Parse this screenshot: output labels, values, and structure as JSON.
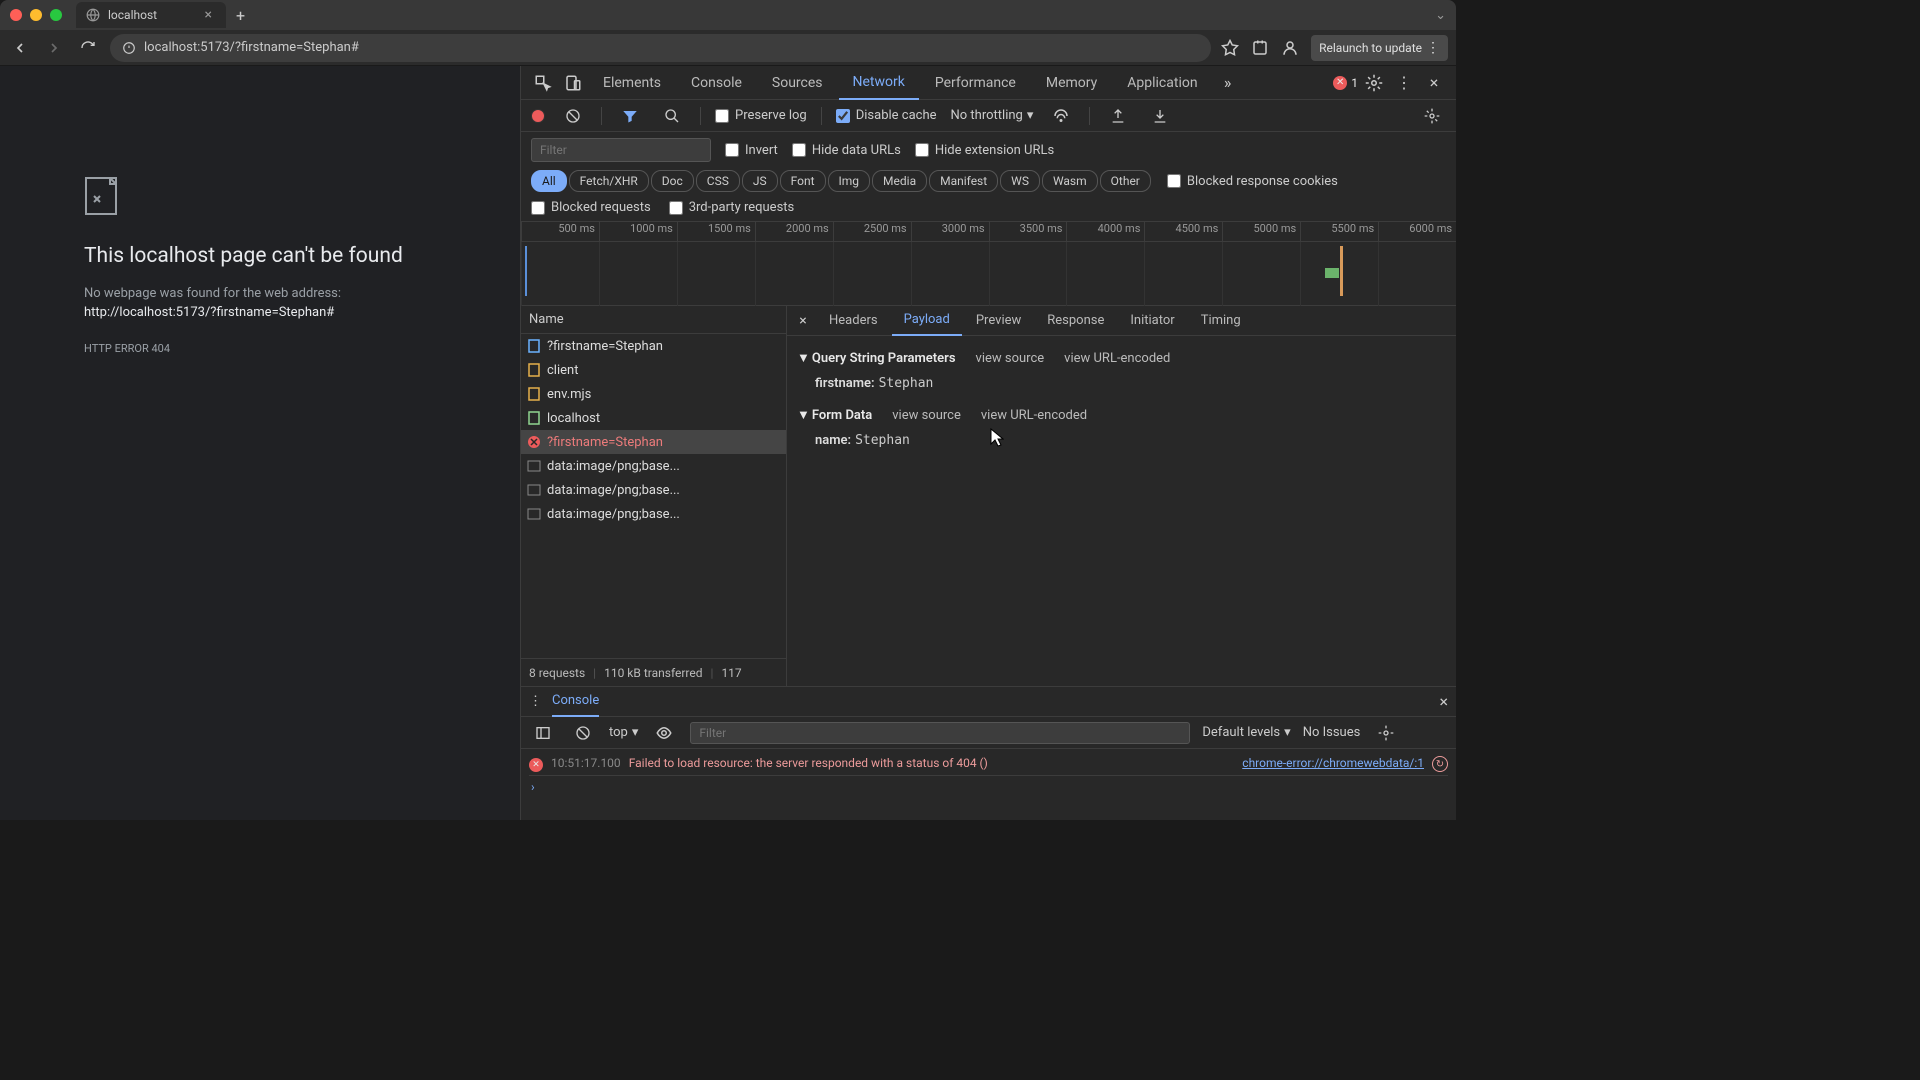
{
  "window": {
    "tab_title": "localhost",
    "url": "localhost:5173/?firstname=Stephan#",
    "relaunch": "Relaunch to update"
  },
  "page": {
    "heading": "This localhost page can't be found",
    "subtext": "No webpage was found for the web address:",
    "requested_url": "http://localhost:5173/?firstname=Stephan#",
    "error_code": "HTTP ERROR 404"
  },
  "devtools": {
    "tabs": [
      "Elements",
      "Console",
      "Sources",
      "Network",
      "Performance",
      "Memory",
      "Application"
    ],
    "active_tab": "Network",
    "error_count": "1"
  },
  "network_toolbar": {
    "preserve_log": "Preserve log",
    "disable_cache": "Disable cache",
    "throttling": "No throttling"
  },
  "filters": {
    "placeholder": "Filter",
    "invert": "Invert",
    "hide_data": "Hide data URLs",
    "hide_ext": "Hide extension URLs",
    "types": [
      "All",
      "Fetch/XHR",
      "Doc",
      "CSS",
      "JS",
      "Font",
      "Img",
      "Media",
      "Manifest",
      "WS",
      "Wasm",
      "Other"
    ],
    "blocked_cookies": "Blocked response cookies",
    "blocked_req": "Blocked requests",
    "third_party": "3rd-party requests"
  },
  "waterfall_ticks": [
    "500 ms",
    "1000 ms",
    "1500 ms",
    "2000 ms",
    "2500 ms",
    "3000 ms",
    "3500 ms",
    "4000 ms",
    "4500 ms",
    "5000 ms",
    "5500 ms",
    "6000 ms"
  ],
  "requests": {
    "header": "Name",
    "rows": [
      {
        "name": "?firstname=Stephan",
        "kind": "doc"
      },
      {
        "name": "client",
        "kind": "js"
      },
      {
        "name": "env.mjs",
        "kind": "js"
      },
      {
        "name": "localhost",
        "kind": "ws"
      },
      {
        "name": "?firstname=Stephan",
        "kind": "error"
      },
      {
        "name": "data:image/png;base...",
        "kind": "img"
      },
      {
        "name": "data:image/png;base...",
        "kind": "img"
      },
      {
        "name": "data:image/png;base...",
        "kind": "img"
      }
    ],
    "footer": {
      "count": "8 requests",
      "transferred": "110 kB transferred",
      "resources": "117"
    }
  },
  "detail": {
    "tabs": [
      "Headers",
      "Payload",
      "Preview",
      "Response",
      "Initiator",
      "Timing"
    ],
    "active": "Payload",
    "qsp": {
      "title": "Query String Parameters",
      "view_source": "view source",
      "view_url": "view URL-encoded",
      "key": "firstname:",
      "val": "Stephan"
    },
    "form": {
      "title": "Form Data",
      "view_source": "view source",
      "view_url": "view URL-encoded",
      "key": "name:",
      "val": "Stephan"
    }
  },
  "console": {
    "tab": "Console",
    "scope": "top",
    "filter_placeholder": "Filter",
    "levels": "Default levels",
    "issues": "No Issues",
    "log": {
      "time": "10:51:17.100",
      "msg": "Failed to load resource: the server responded with a status of 404 ()",
      "src": "chrome-error://chromewebdata/:1"
    }
  }
}
